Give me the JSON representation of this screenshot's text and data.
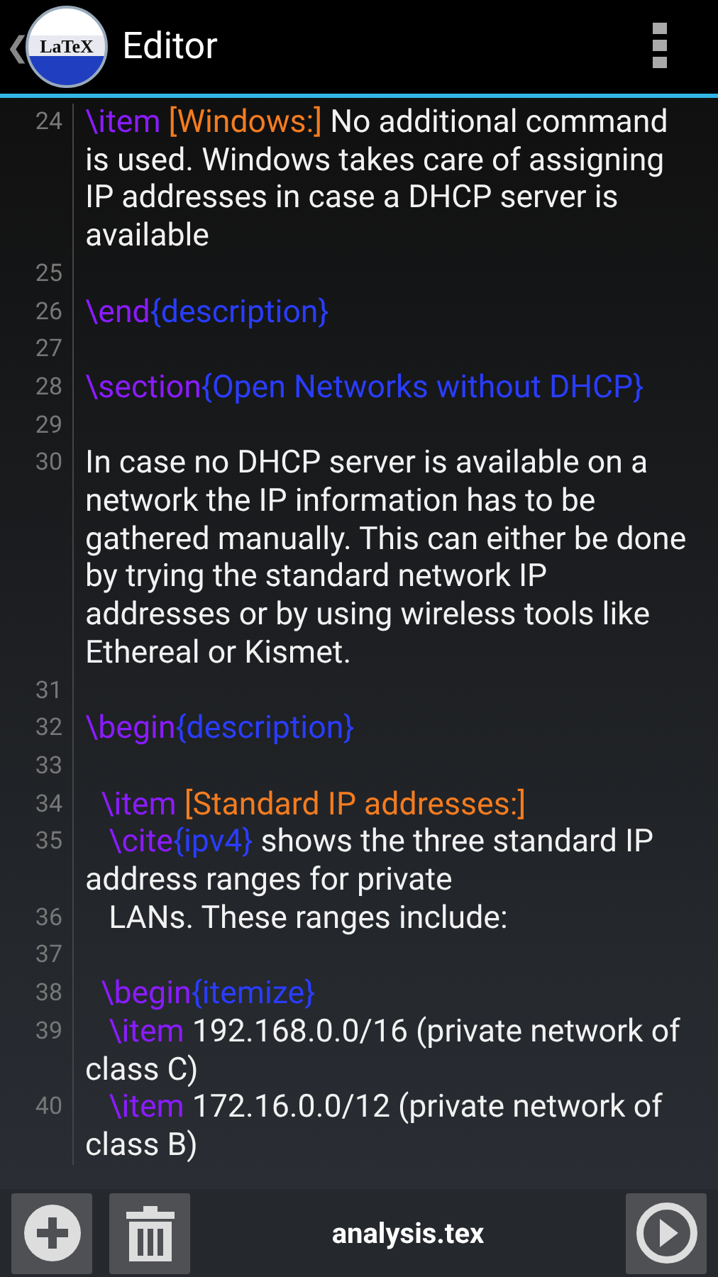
{
  "action_bar": {
    "title": "Editor",
    "logo_text": "LaTeX",
    "back_glyph": "❮"
  },
  "lines": [
    {
      "number": "24",
      "segments": [
        {
          "kind": "command",
          "text": "\\item "
        },
        {
          "kind": "option",
          "text": "[Windows:]"
        },
        {
          "kind": "text",
          "text": " No additional command is used. Windows takes care of assigning IP addresses in case a DHCP server is available"
        }
      ]
    },
    {
      "number": "25"
    },
    {
      "number": "26",
      "segments": [
        {
          "kind": "command",
          "text": "\\end"
        },
        {
          "kind": "argument",
          "text": "{description}"
        }
      ]
    },
    {
      "number": "27"
    },
    {
      "number": "28",
      "segments": [
        {
          "kind": "command",
          "text": "\\section"
        },
        {
          "kind": "argument",
          "text": "{Open Networks without DHCP}"
        }
      ]
    },
    {
      "number": "29"
    },
    {
      "number": "30",
      "segments": [
        {
          "kind": "text",
          "text": "In case no DHCP server is available on a network the IP information has to be gathered manually. This can either be done by trying the standard network IP addresses or by using wireless tools like Ethereal or Kismet."
        }
      ]
    },
    {
      "number": "31"
    },
    {
      "number": "32",
      "segments": [
        {
          "kind": "command",
          "text": "\\begin"
        },
        {
          "kind": "argument",
          "text": "{description}"
        }
      ]
    },
    {
      "number": "33"
    },
    {
      "number": "34",
      "segments": [
        {
          "kind": "command",
          "text": "  \\item "
        },
        {
          "kind": "option",
          "text": "[Standard IP addresses:]"
        }
      ]
    },
    {
      "number": "35",
      "segments": [
        {
          "kind": "command",
          "text": "   \\cite"
        },
        {
          "kind": "argument",
          "text": "{ipv4}"
        },
        {
          "kind": "text",
          "text": " shows the three standard IP address ranges for private"
        }
      ]
    },
    {
      "number": "36",
      "segments": [
        {
          "kind": "text",
          "text": "   LANs. These ranges include:"
        }
      ]
    },
    {
      "number": "37"
    },
    {
      "number": "38",
      "segments": [
        {
          "kind": "command",
          "text": "  \\begin"
        },
        {
          "kind": "argument",
          "text": "{itemize}"
        }
      ]
    },
    {
      "number": "39",
      "segments": [
        {
          "kind": "command",
          "text": "   \\item"
        },
        {
          "kind": "text",
          "text": " 192.168.0.0/16 (private network of class C)"
        }
      ]
    },
    {
      "number": "40",
      "segments": [
        {
          "kind": "command",
          "text": "   \\item"
        },
        {
          "kind": "text",
          "text": " 172.16.0.0/12 (private network of class B)"
        }
      ]
    }
  ],
  "bottom_bar": {
    "file_name": "analysis.tex"
  }
}
